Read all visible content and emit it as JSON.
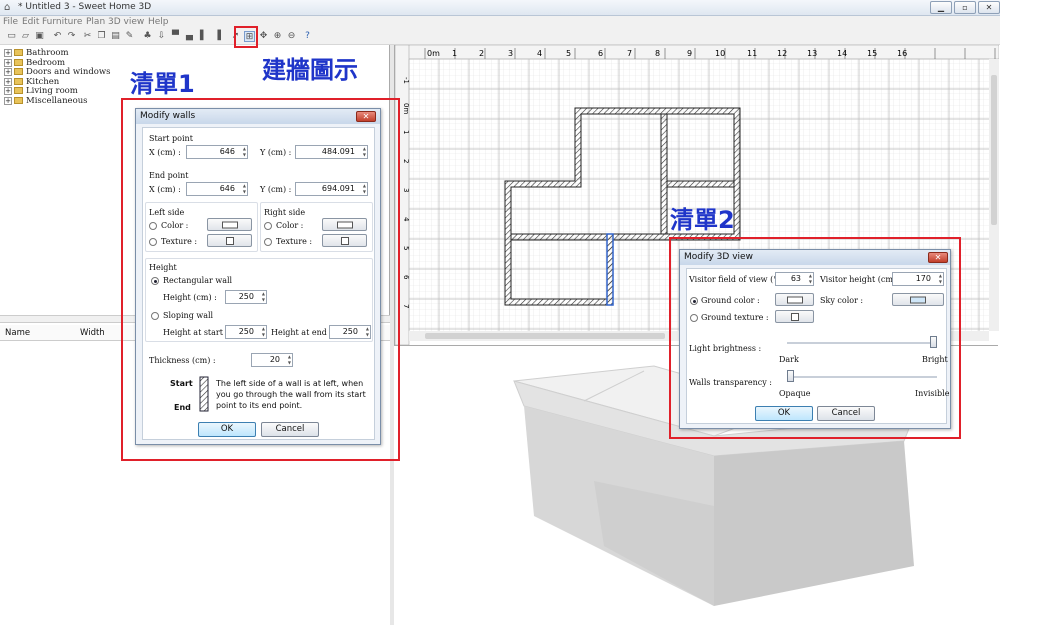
{
  "window": {
    "title": "* Untitled 3 - Sweet Home 3D",
    "controls": [
      "▁",
      "▫",
      "✕"
    ]
  },
  "menu": [
    "File",
    "Edit",
    "Furniture",
    "Plan",
    "3D view",
    "Help"
  ],
  "catalog": {
    "items": [
      "Bathroom",
      "Bedroom",
      "Doors and windows",
      "Kitchen",
      "Living room",
      "Miscellaneous"
    ]
  },
  "furniture_table": {
    "columns": [
      "Name",
      "Width"
    ]
  },
  "plan": {
    "ruler_x": [
      "0m",
      "1",
      "2",
      "3",
      "4",
      "5",
      "6",
      "7",
      "8",
      "9",
      "10",
      "11",
      "12",
      "13",
      "14",
      "15",
      "16"
    ],
    "ruler_y": [
      "-1",
      "0m",
      "1",
      "2",
      "3",
      "4",
      "5",
      "6",
      "7"
    ]
  },
  "annotations": {
    "list1": "清單1",
    "list2": "清單2",
    "wall_icon": "建牆圖示"
  },
  "modify_walls": {
    "title": "Modify walls",
    "start_point": "Start point",
    "end_point": "End point",
    "x_label": "X (cm) :",
    "y_label": "Y (cm) :",
    "start_x": "646",
    "start_y": "484.091",
    "end_x": "646",
    "end_y": "694.091",
    "left_side": "Left side",
    "right_side": "Right side",
    "color": "Color :",
    "texture": "Texture :",
    "height": "Height",
    "rectangular": "Rectangular wall",
    "height_cm": "Height (cm) :",
    "height_val": "250",
    "sloping": "Sloping wall",
    "height_start": "Height at start :",
    "height_start_val": "250",
    "height_end": "Height at end :",
    "height_end_val": "250",
    "thickness": "Thickness (cm) :",
    "thickness_val": "20",
    "start": "Start",
    "end": "End",
    "hint": "The left side of a wall is at left, when you go through the wall from its start point to its end point.",
    "ok": "OK",
    "cancel": "Cancel"
  },
  "modify_3d": {
    "title": "Modify 3D view",
    "fov": "Visitor field of view (°) :",
    "fov_val": "63",
    "visitor_height": "Visitor height (cm) :",
    "visitor_height_val": "170",
    "ground_color": "Ground color :",
    "sky_color": "Sky color :",
    "ground_texture": "Ground texture :",
    "light": "Light brightness :",
    "dark": "Dark",
    "bright": "Bright",
    "light_level": 1.0,
    "walls": "Walls transparency :",
    "opaque": "Opaque",
    "invisible": "Invisible",
    "walls_level": 0.0,
    "ok": "OK",
    "cancel": "Cancel"
  },
  "colors": {
    "annotation": "#1f35c9",
    "highlight_box": "#e0202a",
    "sky": "#cfe6f8"
  }
}
